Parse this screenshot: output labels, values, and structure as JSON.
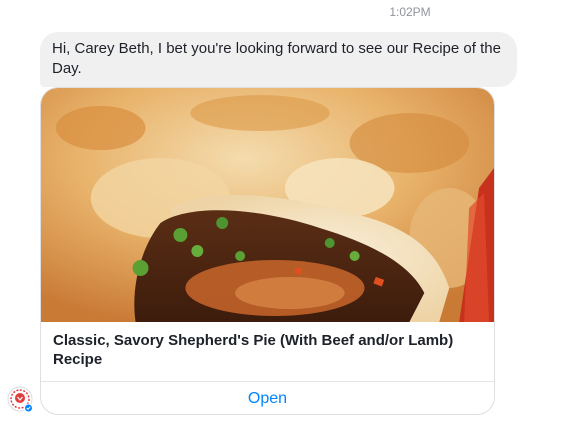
{
  "timestamp": "1:02PM",
  "message": {
    "text": "Hi, Carey Beth, I bet you're looking forward to see our Recipe of the Day."
  },
  "card": {
    "image_icon": "shepherds-pie-photo",
    "title": "Classic, Savory Shepherd's Pie (With Beef and/or Lamb) Recipe",
    "button_label": "Open"
  },
  "avatar": {
    "icon": "bot-avatar-icon"
  },
  "colors": {
    "accent": "#0084ff",
    "bubble": "#f1f0f0"
  }
}
